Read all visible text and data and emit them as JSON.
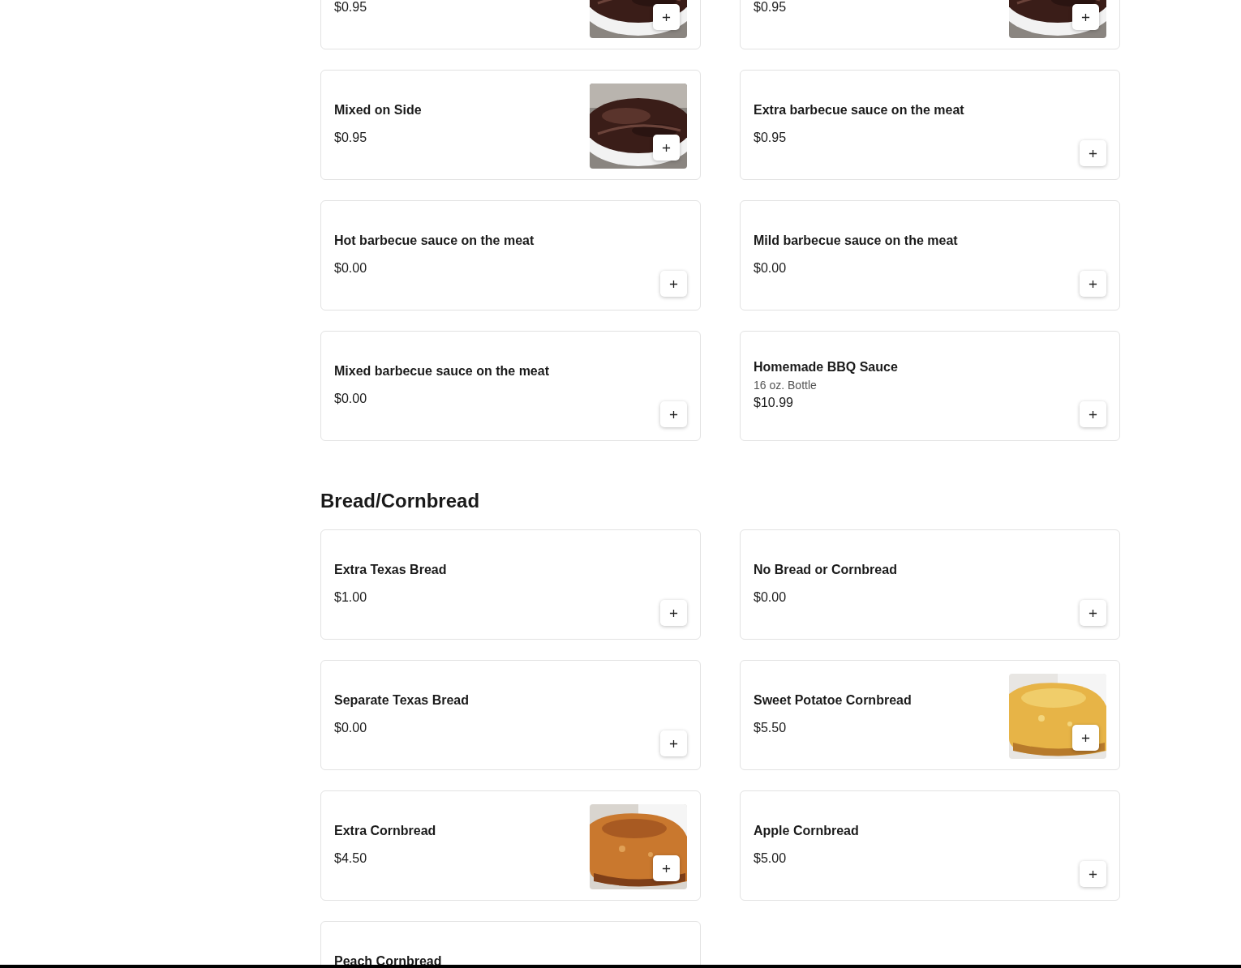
{
  "sections": [
    {
      "items": [
        {
          "price": "$0.95",
          "has_picture": true
        },
        {
          "price": "$0.95",
          "has_picture": true
        },
        {
          "name": "Mixed on Side",
          "price": "$0.95",
          "has_picture": true
        },
        {
          "name": "Extra barbecue sauce on the meat",
          "price": "$0.95",
          "has_picture": false
        },
        {
          "name": "Hot barbecue sauce on the meat",
          "price": "$0.00",
          "has_picture": false
        },
        {
          "name": "Mild barbecue sauce on the meat",
          "price": "$0.00",
          "has_picture": false
        },
        {
          "name": "Mixed barbecue sauce on the meat",
          "price": "$0.00",
          "has_picture": false
        },
        {
          "name": "Homemade BBQ Sauce",
          "description": "16 oz. Bottle",
          "price": "$10.99",
          "has_picture": false
        }
      ]
    },
    {
      "title": "Bread/Cornbread",
      "items": [
        {
          "name": "Extra Texas Bread",
          "price": "$1.00",
          "has_picture": false
        },
        {
          "name": "No Bread or Cornbread",
          "price": "$0.00",
          "has_picture": false
        },
        {
          "name": "Separate Texas Bread",
          "price": "$0.00",
          "has_picture": false
        },
        {
          "name": "Sweet Potatoe Cornbread",
          "price": "$5.50",
          "has_picture": true
        },
        {
          "name": "Extra Cornbread",
          "price": "$4.50",
          "has_picture": true
        },
        {
          "name": "Apple Cornbread",
          "price": "$5.00",
          "has_picture": false
        },
        {
          "name": "Peach Cornbread",
          "has_picture": false
        }
      ]
    }
  ]
}
